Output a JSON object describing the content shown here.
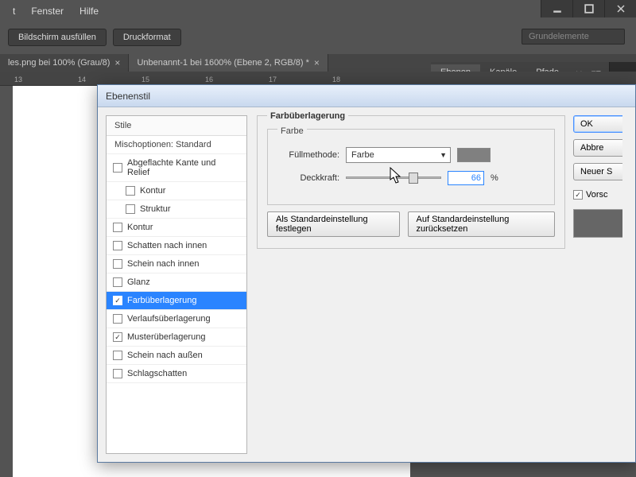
{
  "menu": {
    "t": "t",
    "fenster": "Fenster",
    "hilfe": "Hilfe"
  },
  "toolbar": {
    "fill_screen": "Bildschirm ausfüllen",
    "print_format": "Druckformat",
    "workspace": "Grundelemente"
  },
  "tabs": {
    "doc1": "les.png bei 100% (Grau/8)",
    "doc2": "Unbenannt-1 bei 1600% (Ebene 2, RGB/8) *"
  },
  "ruler": {
    "m13": "13",
    "m14": "14",
    "m15": "15",
    "m16": "16",
    "m17": "17",
    "m18": "18"
  },
  "panels": {
    "ebenen": "Ebenen",
    "kanale": "Kanäle",
    "pfade": "Pfade",
    "arrows": "▸▸",
    "menu_icon": "▾≡"
  },
  "dialog": {
    "title": "Ebenenstil",
    "styles_header": "Stile",
    "blend_options": "Mischoptionen: Standard",
    "items": {
      "bevel": "Abgeflachte Kante und Relief",
      "kontur_sub": "Kontur",
      "struktur": "Struktur",
      "kontur": "Kontur",
      "inner_shadow": "Schatten nach innen",
      "inner_glow": "Schein nach innen",
      "satin": "Glanz",
      "color_overlay": "Farbüberlagerung",
      "gradient_overlay": "Verlaufsüberlagerung",
      "pattern_overlay": "Musterüberlagerung",
      "outer_glow": "Schein nach außen",
      "drop_shadow": "Schlagschatten"
    },
    "group_title": "Farbüberlagerung",
    "subgroup": "Farbe",
    "fill_method_label": "Füllmethode:",
    "fill_method_value": "Farbe",
    "opacity_label": "Deckkraft:",
    "opacity_value": "66",
    "opacity_unit": "%",
    "set_default": "Als Standardeinstellung festlegen",
    "reset_default": "Auf Standardeinstellung zurücksetzen",
    "ok": "OK",
    "cancel": "Abbre",
    "new_style": "Neuer S",
    "preview": "Vorsc"
  }
}
